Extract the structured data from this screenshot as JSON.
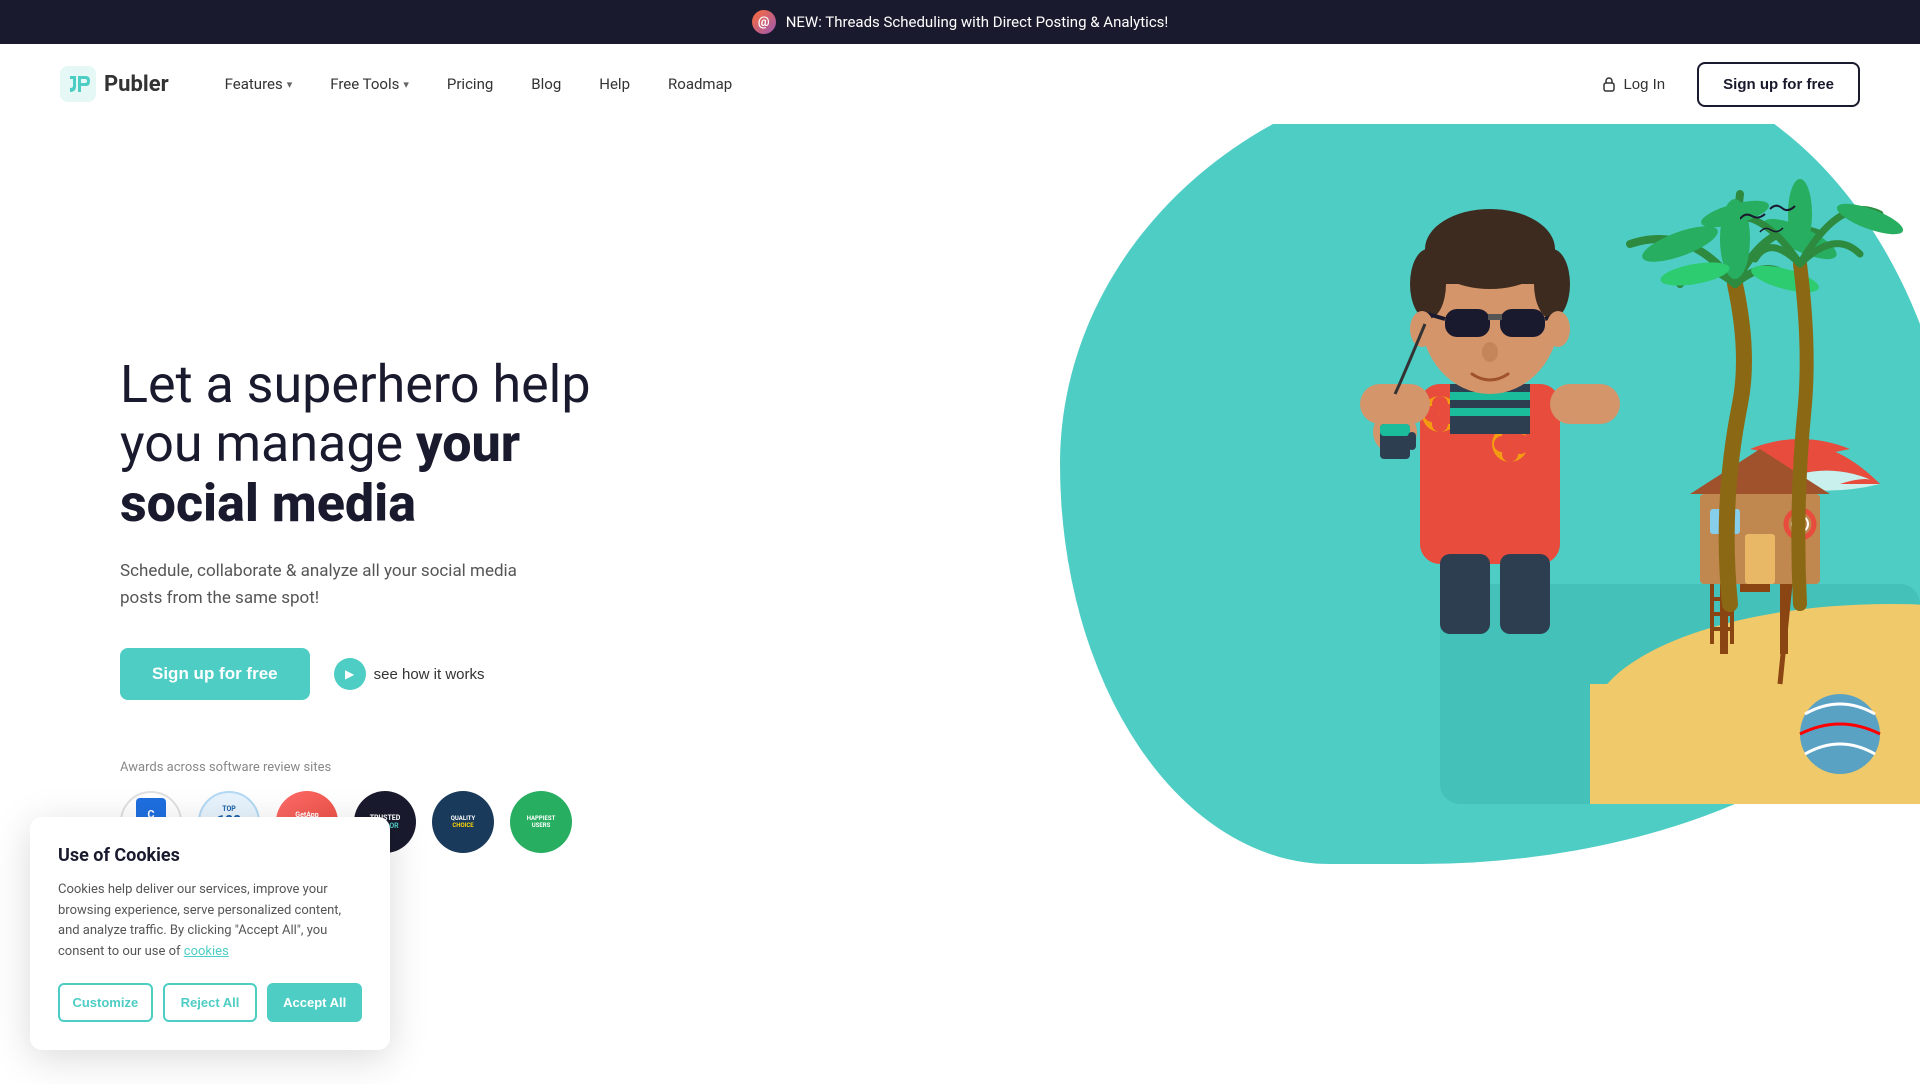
{
  "announcement": {
    "icon_label": "threads-icon",
    "text": "NEW: Threads Scheduling with Direct Posting & Analytics!"
  },
  "header": {
    "logo_text": "Publer",
    "nav_items": [
      {
        "label": "Features",
        "has_dropdown": true
      },
      {
        "label": "Free Tools",
        "has_dropdown": true
      },
      {
        "label": "Pricing",
        "has_dropdown": false
      },
      {
        "label": "Blog",
        "has_dropdown": false
      },
      {
        "label": "Help",
        "has_dropdown": false
      },
      {
        "label": "Roadmap",
        "has_dropdown": false
      }
    ],
    "login_label": "Log In",
    "signup_label": "Sign up for free"
  },
  "hero": {
    "title_line1": "Let a superhero help",
    "title_line2": "you manage ",
    "title_bold": "your",
    "title_line3": "social media",
    "subtitle": "Schedule, collaborate & analyze all your social media posts from the same spot!",
    "cta_primary": "Sign up for free",
    "cta_secondary": "see how it works",
    "awards_label": "Awards across software review sites",
    "badges": [
      {
        "id": "capterra",
        "label": "Capterra\nSHORTLIST\n2023"
      },
      {
        "id": "top100",
        "label": "Top 100"
      },
      {
        "id": "getapp",
        "label": "GetApp\nCategory\nChampion"
      },
      {
        "id": "trusted",
        "label": "Trusted\nVendor"
      },
      {
        "id": "quality",
        "label": "Quality\nChoice"
      },
      {
        "id": "happiest",
        "label": "Happiest\nUsers"
      }
    ]
  },
  "cookie": {
    "title": "Use of Cookies",
    "text": "Cookies help deliver our services, improve your browsing experience, serve personalized content, and analyze traffic. By clicking \"Accept All\", you consent to our use of",
    "link_text": "cookies",
    "btn_customize": "Customize",
    "btn_reject": "Reject All",
    "btn_accept": "Accept All"
  },
  "colors": {
    "teal": "#4ecdc4",
    "dark": "#1a1a2e",
    "text_gray": "#555555"
  }
}
